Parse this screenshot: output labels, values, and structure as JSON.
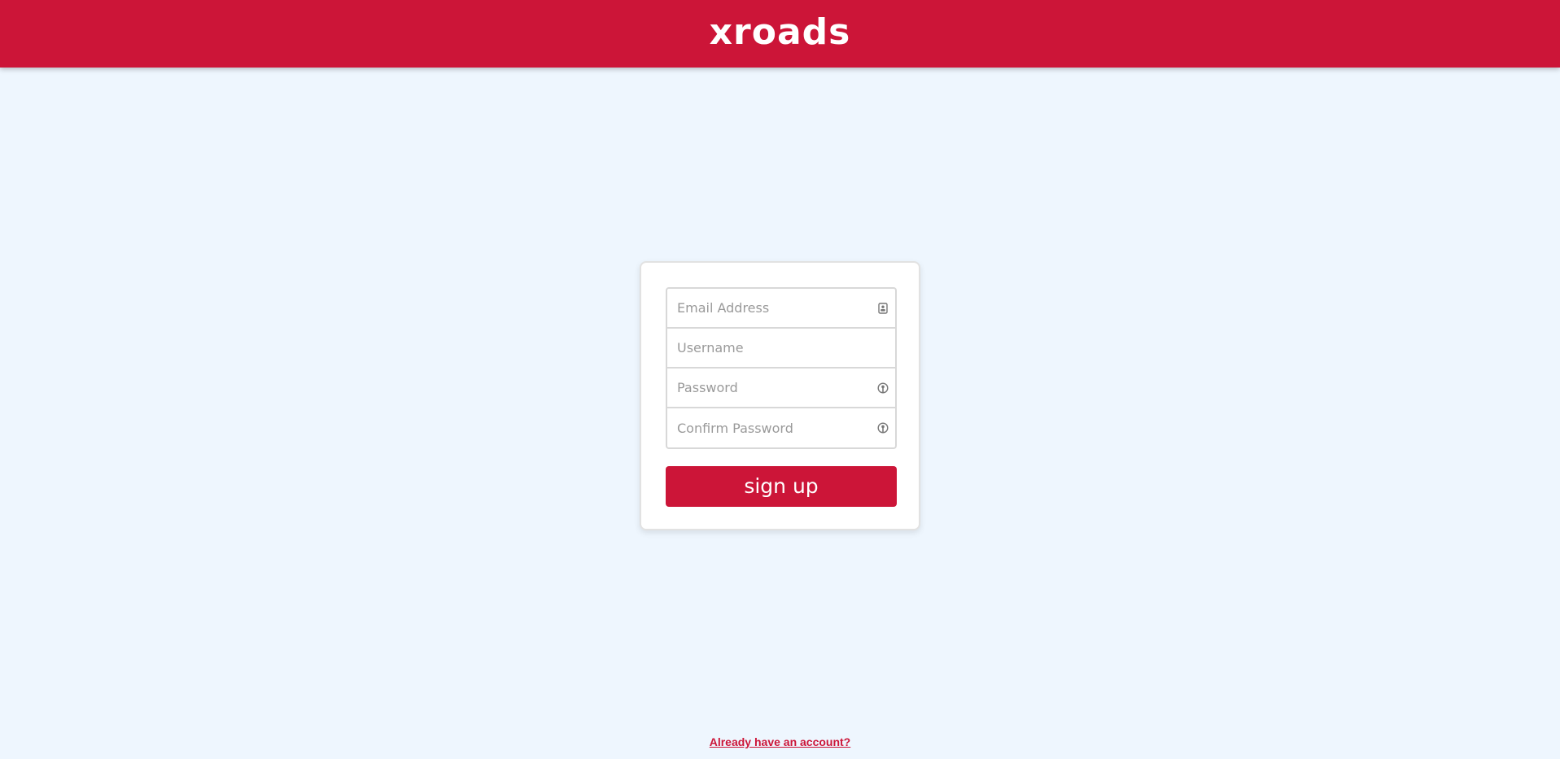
{
  "header": {
    "logo_text": "xroads"
  },
  "form": {
    "email": {
      "placeholder": "Email Address",
      "value": "",
      "icon": "id-card-icon"
    },
    "username": {
      "placeholder": "Username",
      "value": ""
    },
    "password": {
      "placeholder": "Password",
      "value": "",
      "icon": "lock-icon"
    },
    "confirm_password": {
      "placeholder": "Confirm Password",
      "value": "",
      "icon": "lock-icon"
    },
    "submit_label": "sign up"
  },
  "footer": {
    "login_link": "Already have an account?"
  },
  "colors": {
    "brand": "#cc1538",
    "background": "#eef6fe",
    "card": "#ffffff"
  }
}
